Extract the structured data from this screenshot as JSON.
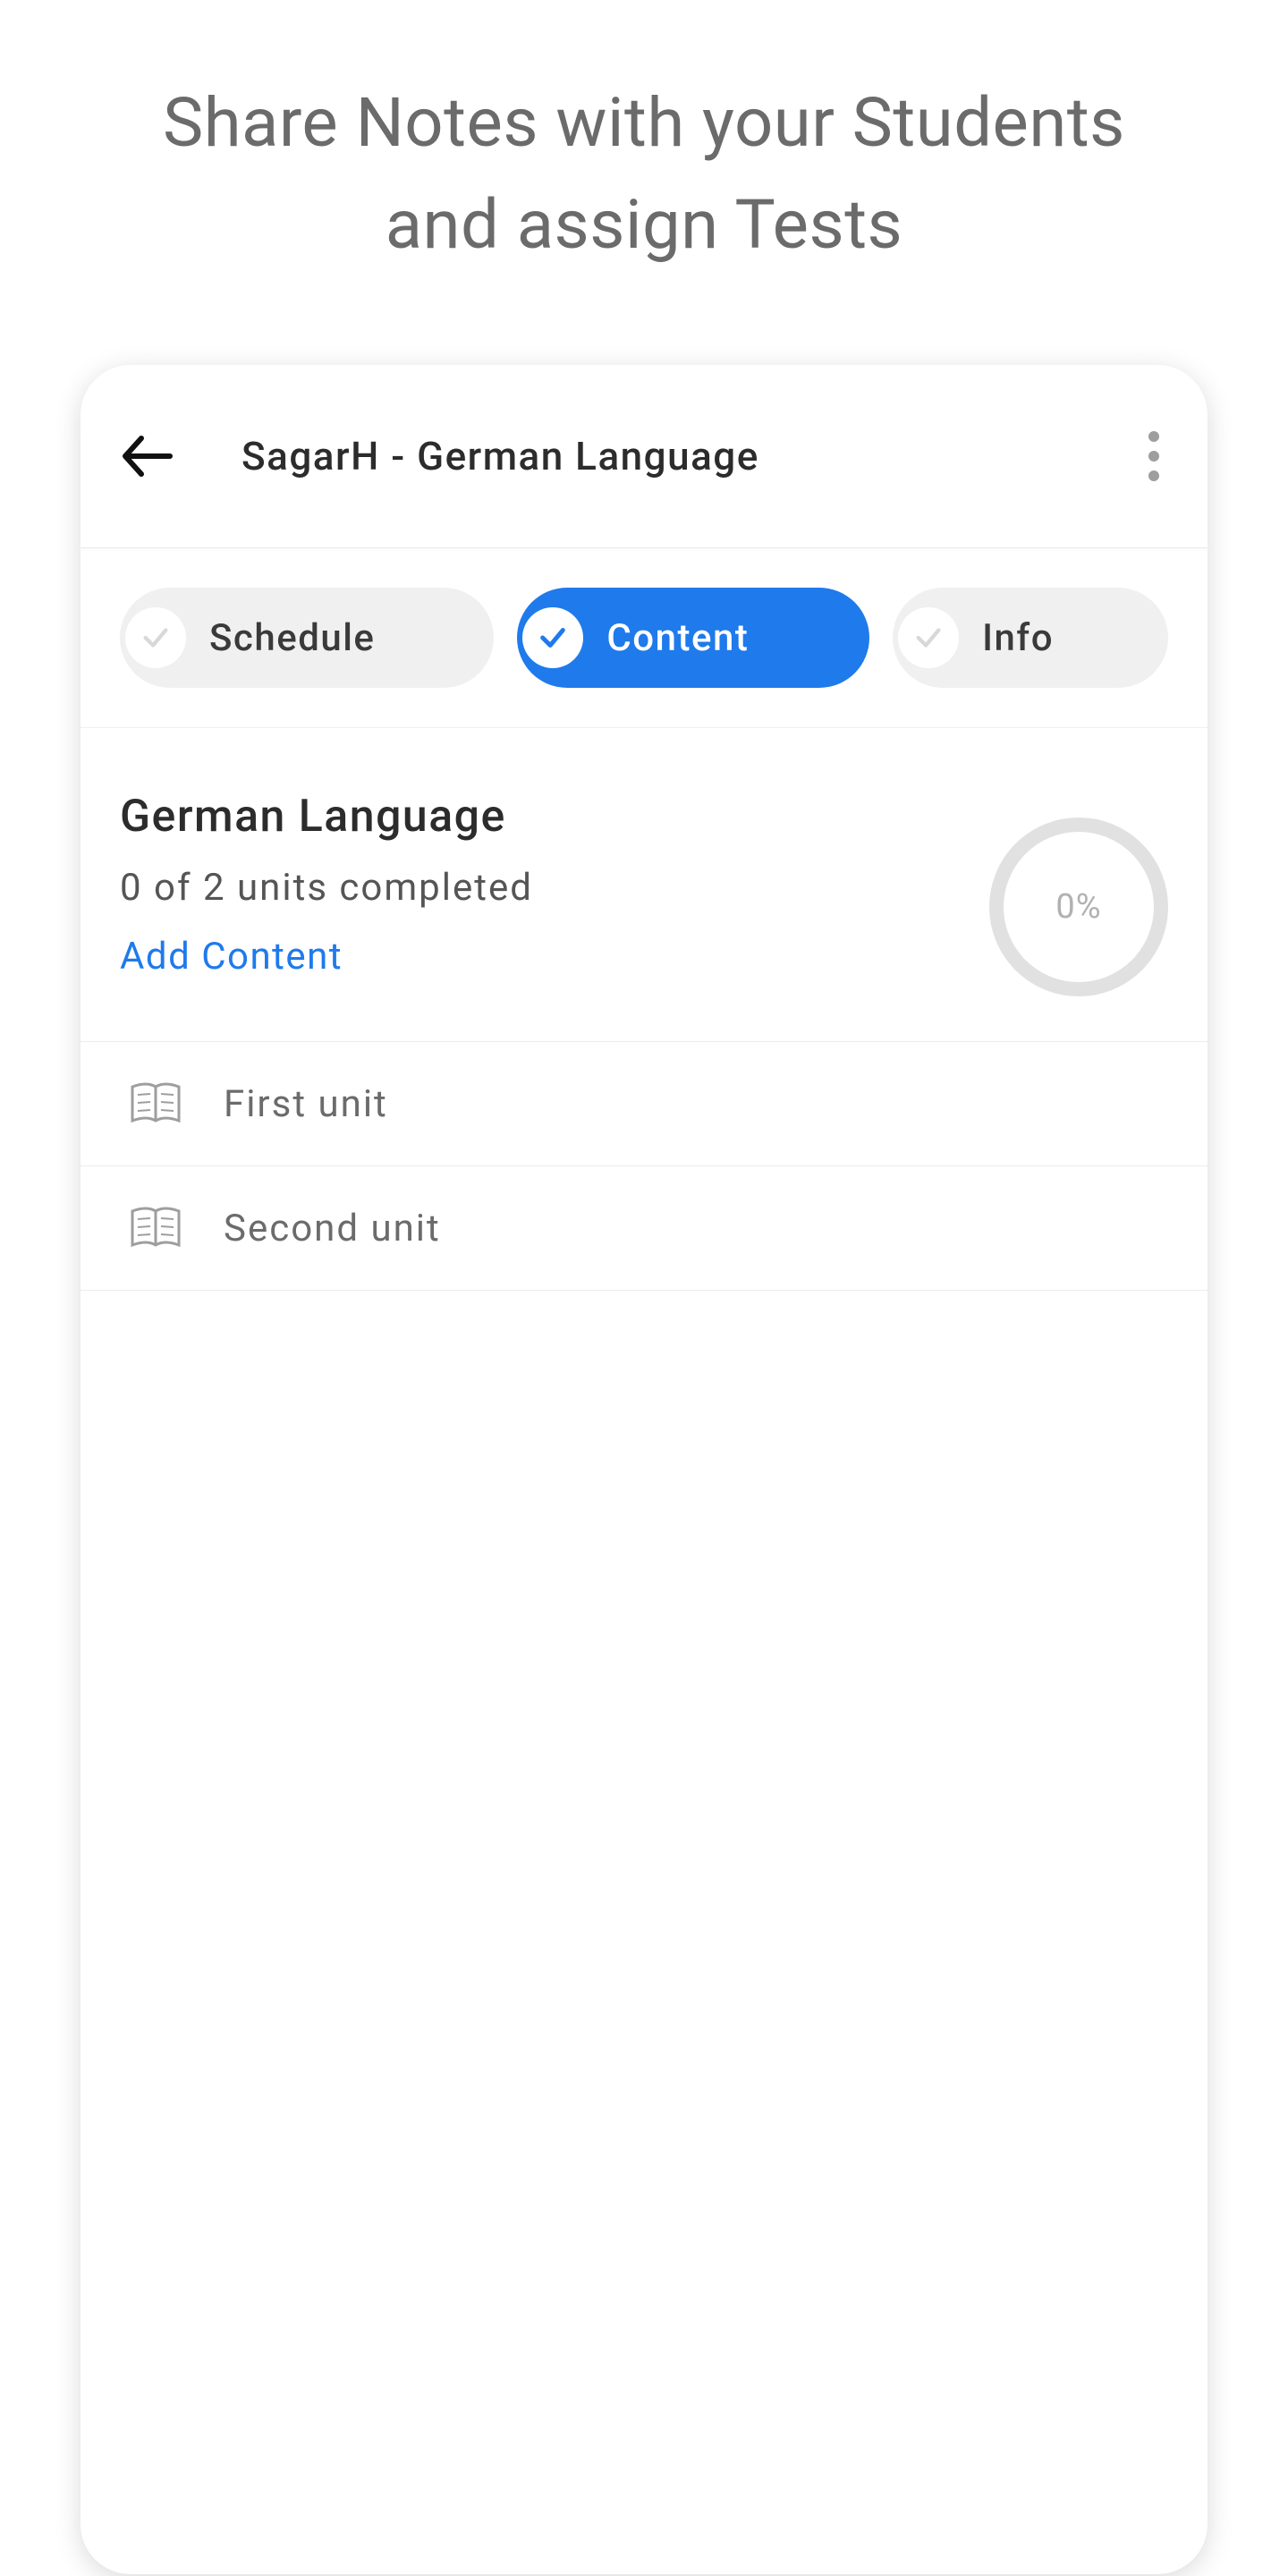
{
  "hero": {
    "line1": "Share Notes with your Students",
    "line2": "and assign Tests"
  },
  "header": {
    "title": "SagarH - German Language"
  },
  "tabs": [
    {
      "label": "Schedule",
      "active": false
    },
    {
      "label": "Content",
      "active": true
    },
    {
      "label": "Info",
      "active": false
    }
  ],
  "course": {
    "title": "German Language",
    "subtitle": "0 of 2 units completed",
    "add_label": "Add Content",
    "progress_text": "0%"
  },
  "units": [
    {
      "label": "First unit"
    },
    {
      "label": "Second unit"
    }
  ]
}
